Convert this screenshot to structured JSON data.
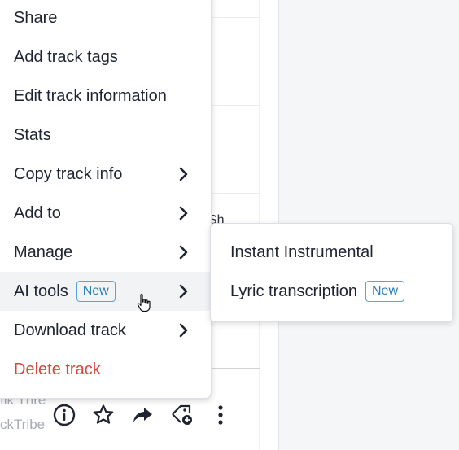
{
  "menu": {
    "items": [
      {
        "label": "Share"
      },
      {
        "label": "Add track tags"
      },
      {
        "label": "Edit track information"
      },
      {
        "label": "Stats"
      },
      {
        "label": "Copy track info"
      },
      {
        "label": "Add to"
      },
      {
        "label": "Manage"
      },
      {
        "label": "AI tools",
        "badge": "New"
      },
      {
        "label": "Download track"
      },
      {
        "label": "Delete track"
      }
    ]
  },
  "submenu": {
    "items": [
      {
        "label": "Instant Instrumental"
      },
      {
        "label": "Lyric transcription",
        "badge": "New"
      }
    ]
  },
  "background": {
    "partial_text": "Sh",
    "footer_line1": "ılk Thre",
    "footer_line2": "ckTribe",
    "icons": [
      "info-icon",
      "star-icon",
      "share-arrow-icon",
      "add-tag-icon",
      "more-vertical-icon"
    ]
  },
  "colors": {
    "danger": "#d9463e",
    "badge_text": "#2a7fb8",
    "badge_border": "#5aa5d6",
    "hover_bg": "#f2f3f5"
  }
}
